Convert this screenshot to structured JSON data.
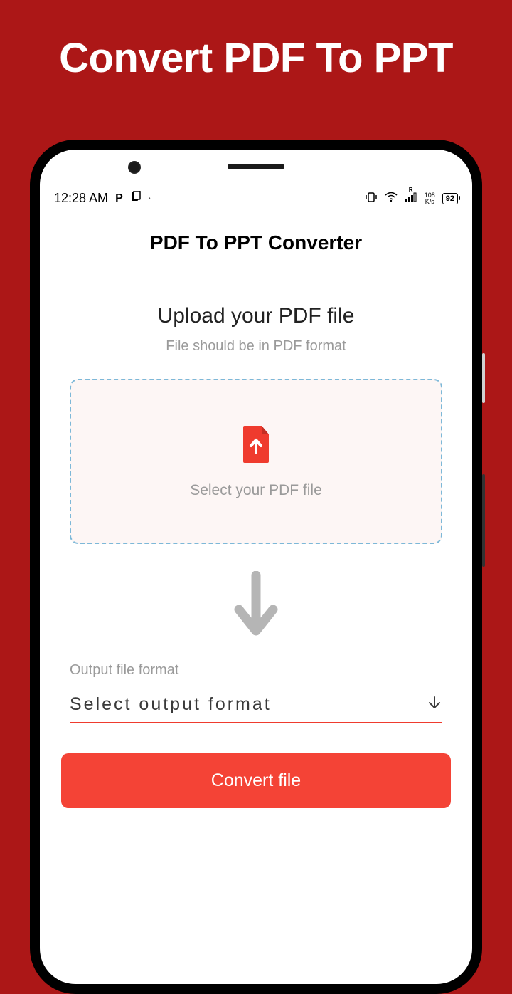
{
  "hero": {
    "title": "Convert PDF To PPT"
  },
  "status": {
    "time": "12:28 AM",
    "icons_left": {
      "p": "P",
      "dot": "•"
    },
    "net_rate": "108",
    "net_unit": "K/s",
    "battery": "92"
  },
  "app": {
    "title": "PDF To PPT Converter"
  },
  "upload": {
    "heading": "Upload your PDF file",
    "subtitle": "File should be in PDF format",
    "dropzone_label": "Select your PDF file"
  },
  "output": {
    "label": "Output file format",
    "select_placeholder": "Select output format"
  },
  "actions": {
    "convert": "Convert file"
  }
}
